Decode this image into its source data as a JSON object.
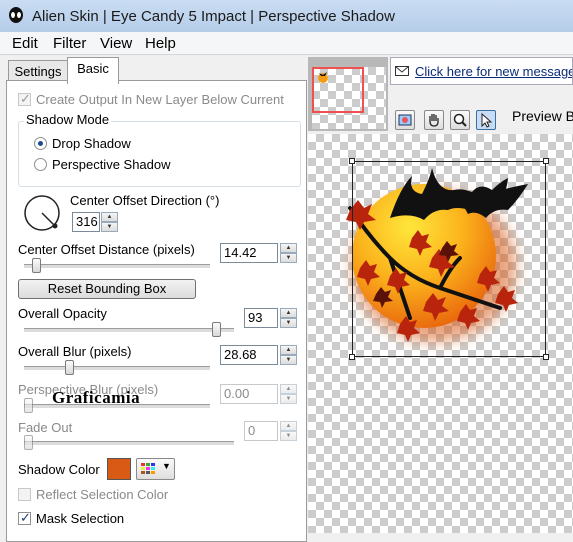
{
  "window": {
    "title": "Alien Skin | Eye Candy 5 Impact | Perspective Shadow"
  },
  "menu": [
    "Edit",
    "Filter",
    "View",
    "Help"
  ],
  "tabs": [
    {
      "label": "Settings",
      "active": false
    },
    {
      "label": "Basic",
      "active": true
    }
  ],
  "basic": {
    "create_output_label": "Create Output In New Layer Below Current",
    "create_output_checked": true,
    "shadow_mode": {
      "title": "Shadow Mode",
      "options": [
        {
          "label": "Drop Shadow",
          "selected": true
        },
        {
          "label": "Perspective Shadow",
          "selected": false
        }
      ]
    },
    "center_offset_direction": {
      "label": "Center Offset Direction (°)",
      "value": "316"
    },
    "center_offset_distance": {
      "label": "Center Offset Distance (pixels)",
      "value": "14.42",
      "slider_fraction": 0.06
    },
    "reset_button": "Reset Bounding Box",
    "overall_opacity": {
      "label": "Overall Opacity",
      "value": "93",
      "slider_fraction": 0.93
    },
    "overall_blur": {
      "label": "Overall Blur (pixels)",
      "value": "28.68",
      "slider_fraction": 0.24
    },
    "perspective_blur": {
      "label": "Perspective Blur (pixels)",
      "value": "0.00",
      "slider_fraction": 0.0
    },
    "fade_out": {
      "label": "Fade Out",
      "value": "0",
      "slider_fraction": 0.0
    },
    "shadow_color": {
      "label": "Shadow Color",
      "color": "#d85a14"
    },
    "reflect_selection": {
      "label": "Reflect Selection Color",
      "checked": false
    },
    "mask_selection": {
      "label": "Mask Selection",
      "checked": true
    }
  },
  "watermark": "Graficamia",
  "preview": {
    "link_text": "Click here for new messages",
    "preview_label": "Preview B",
    "tools": [
      "navigator-icon",
      "hand-icon",
      "zoom-icon",
      "pointer-icon"
    ]
  },
  "colors": {
    "accent": "#3a6ea5",
    "shadow": "#d85a14",
    "orange": "#f39c12"
  }
}
